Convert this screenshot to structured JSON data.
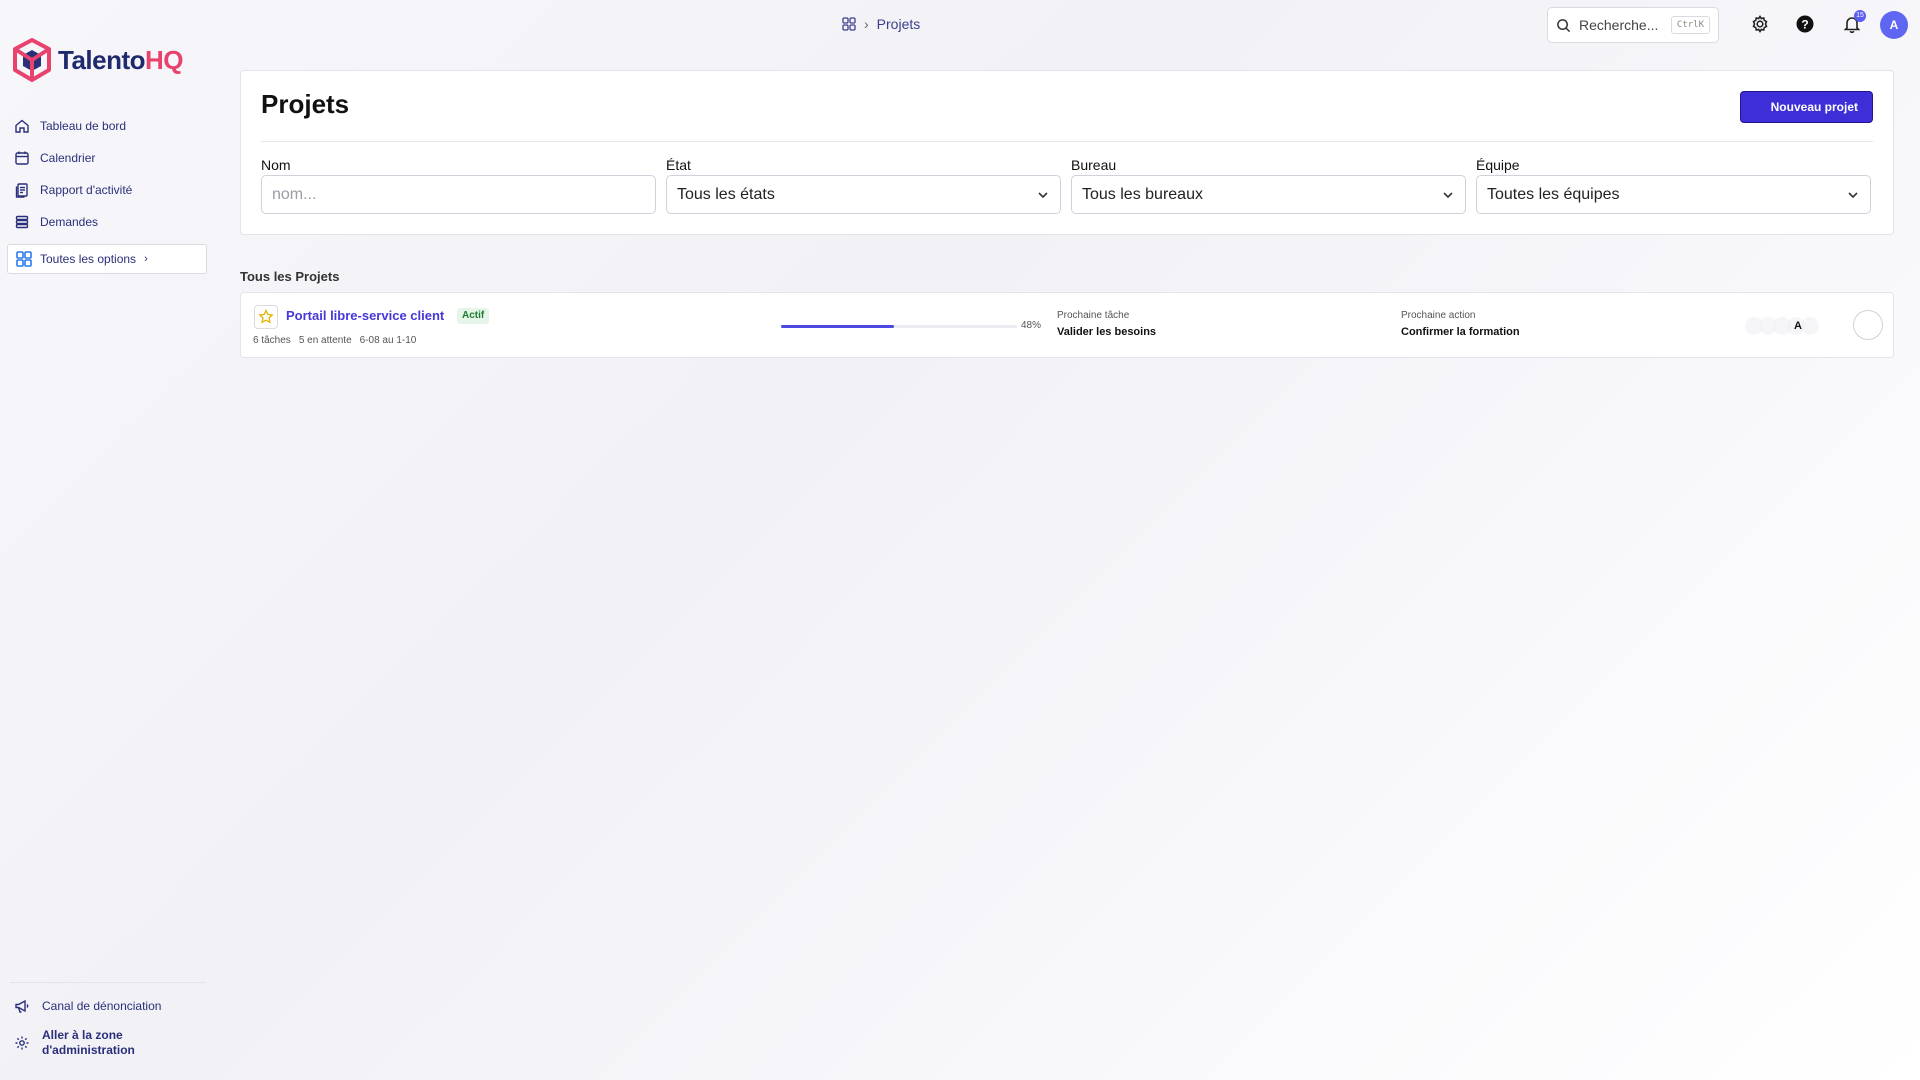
{
  "brand": {
    "name_main": "Talento",
    "name_accent": "HQ",
    "colors": {
      "primary": "#2a2f7a",
      "accent": "#e8436d",
      "button": "#3e2ed8"
    }
  },
  "sidebar": {
    "items": [
      {
        "label": "Tableau de bord",
        "icon": "home-icon"
      },
      {
        "label": "Calendrier",
        "icon": "calendar-icon"
      },
      {
        "label": "Rapport d'activité",
        "icon": "report-icon"
      },
      {
        "label": "Demandes",
        "icon": "stack-icon"
      }
    ],
    "all_options": "Toutes les options",
    "bottom": [
      {
        "label": "Canal de dénonciation",
        "icon": "megaphone-icon"
      },
      {
        "label_line1": "Aller à la zone",
        "label_line2": "d'administration",
        "icon": "gear-icon"
      }
    ]
  },
  "topbar": {
    "breadcrumb": "Projets",
    "search_placeholder": "Recherche...",
    "shortcut": "CtrlK",
    "notifications_count": "15",
    "user_initial": "A"
  },
  "main": {
    "title": "Projets",
    "new_button": "Nouveau projet",
    "filters": [
      {
        "label": "Nom",
        "value": "",
        "placeholder": "nom..."
      },
      {
        "label": "État",
        "value": "Tous les états"
      },
      {
        "label": "Bureau",
        "value": "Tous les bureaux"
      },
      {
        "label": "Équipe",
        "value": "Toutes les équipes"
      }
    ],
    "section_title": "Tous les Projets",
    "projects": [
      {
        "name": "Portail libre-service client",
        "status": "Actif",
        "tasks": "6 tâches",
        "pending": "5 en attente",
        "dates": "6-08 au 1-10",
        "progress_pct": 48,
        "progress_label": "48%",
        "next_task_label": "Prochaine tâche",
        "next_task": "Valider les besoins",
        "next_action_label": "Prochaine action",
        "next_action": "Confirmer la formation",
        "assignee_initial": "A"
      }
    ]
  }
}
